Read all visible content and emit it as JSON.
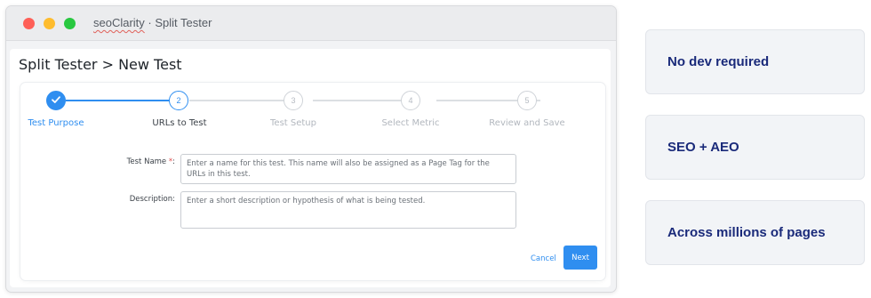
{
  "window": {
    "title_brand": "seoClarity",
    "title_rest": " · Split Tester",
    "traffic_colors": [
      "#fe5f57",
      "#febc2e",
      "#28c840"
    ]
  },
  "page": {
    "title": "Split Tester > New Test"
  },
  "stepper": {
    "steps": [
      {
        "number": "1",
        "label": "Test Purpose",
        "state": "done",
        "icon": "check-icon"
      },
      {
        "number": "2",
        "label": "URLs to Test",
        "state": "active"
      },
      {
        "number": "3",
        "label": "Test Setup",
        "state": "pending"
      },
      {
        "number": "4",
        "label": "Select Metric",
        "state": "pending"
      },
      {
        "number": "5",
        "label": "Review and Save",
        "state": "pending"
      }
    ]
  },
  "form": {
    "test_name_label": "Test Name",
    "required_marker": "*",
    "label_suffix": ":",
    "test_name_value": "",
    "test_name_placeholder": "Enter a name for this test. This name will also be assigned as a Page Tag for the URLs in this test.",
    "description_label": "Description:",
    "description_value": "",
    "description_placeholder": "Enter a short description or hypothesis of what is being tested."
  },
  "actions": {
    "cancel_label": "Cancel",
    "next_label": "Next"
  },
  "features": [
    {
      "text": "No dev required"
    },
    {
      "text": "SEO + AEO"
    },
    {
      "text": "Across millions of pages"
    }
  ],
  "colors": {
    "accent": "#2f8ef0",
    "feature_text": "#1a2a7a",
    "feature_bg": "#f2f4f7",
    "required": "#e04f4f"
  }
}
